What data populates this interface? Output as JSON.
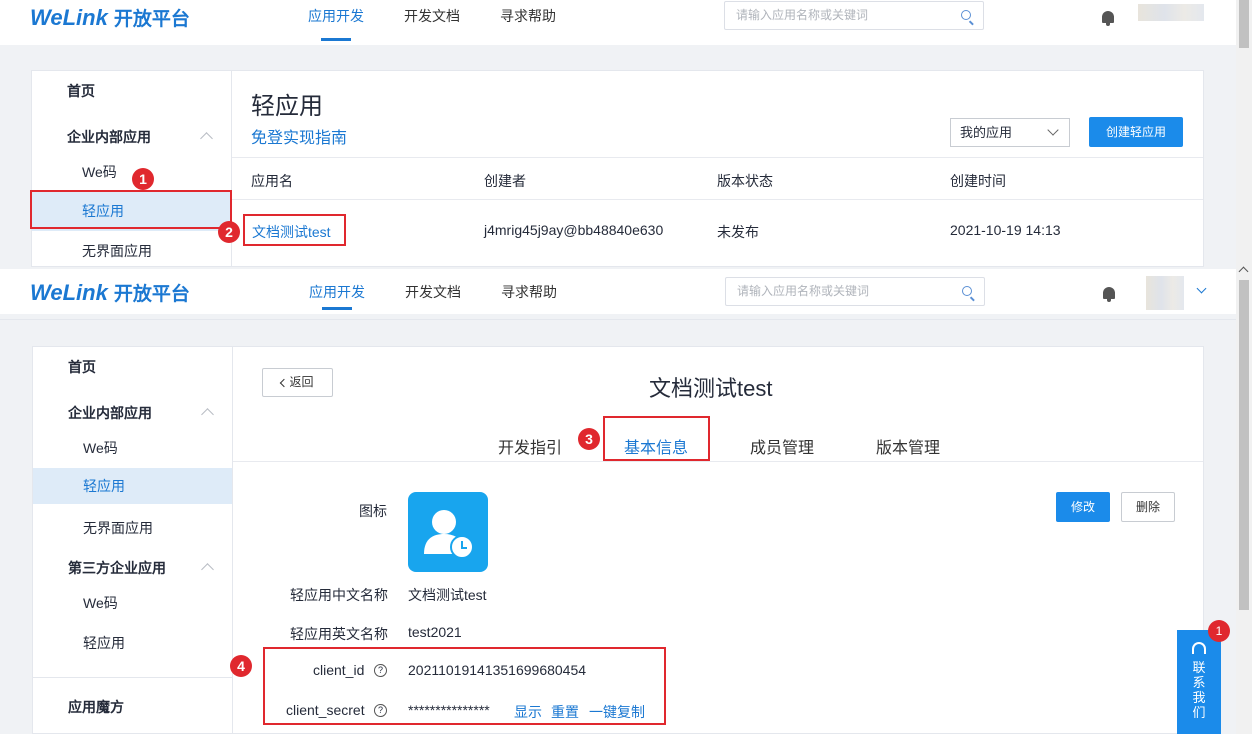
{
  "header": {
    "logo_brand": "WeLink",
    "logo_suffix": "开放平台",
    "nav": [
      "应用开发",
      "开发文档",
      "寻求帮助"
    ],
    "search_placeholder": "请输入应用名称或关键词"
  },
  "top": {
    "sidebar": {
      "home": "首页",
      "group": "企业内部应用",
      "items": [
        "We码",
        "轻应用",
        "无界面应用"
      ]
    },
    "page_title": "轻应用",
    "guide_link": "免登实现指南",
    "filter_value": "我的应用",
    "create_button": "创建轻应用",
    "table": {
      "columns": [
        "应用名",
        "创建者",
        "版本状态",
        "创建时间"
      ],
      "rows": [
        {
          "name": "文档测试test",
          "creator": "j4mrig45j9ay@bb48840e630",
          "status": "未发布",
          "created": "2021-10-19 14:13"
        }
      ]
    },
    "markers": [
      "1",
      "2"
    ]
  },
  "bottom": {
    "sidebar": {
      "home": "首页",
      "group1": "企业内部应用",
      "group1_items": [
        "We码",
        "轻应用",
        "无界面应用"
      ],
      "group2": "第三方企业应用",
      "group2_items": [
        "We码",
        "轻应用"
      ],
      "group3": "应用魔方"
    },
    "back_button": "返回",
    "app_title": "文档测试test",
    "tabs": [
      "开发指引",
      "基本信息",
      "成员管理",
      "版本管理"
    ],
    "edit_button": "修改",
    "delete_button": "删除",
    "fields": {
      "icon_label": "图标",
      "cn_name_label": "轻应用中文名称",
      "cn_name_value": "文档测试test",
      "en_name_label": "轻应用英文名称",
      "en_name_value": "test2021",
      "client_id_label": "client_id",
      "client_id_value": "20211019141351699680454",
      "client_secret_label": "client_secret",
      "client_secret_value": "***************",
      "show_link": "显示",
      "reset_link": "重置",
      "copy_link": "一键复制"
    },
    "markers": [
      "3",
      "4"
    ],
    "contact": {
      "label": [
        "联",
        "系",
        "我",
        "们"
      ],
      "badge": "1"
    }
  },
  "colors": {
    "brand": "#1b78d2",
    "primary_button": "#1b8bea",
    "annotation": "#e0282e",
    "selected_bg": "#deebf8"
  }
}
